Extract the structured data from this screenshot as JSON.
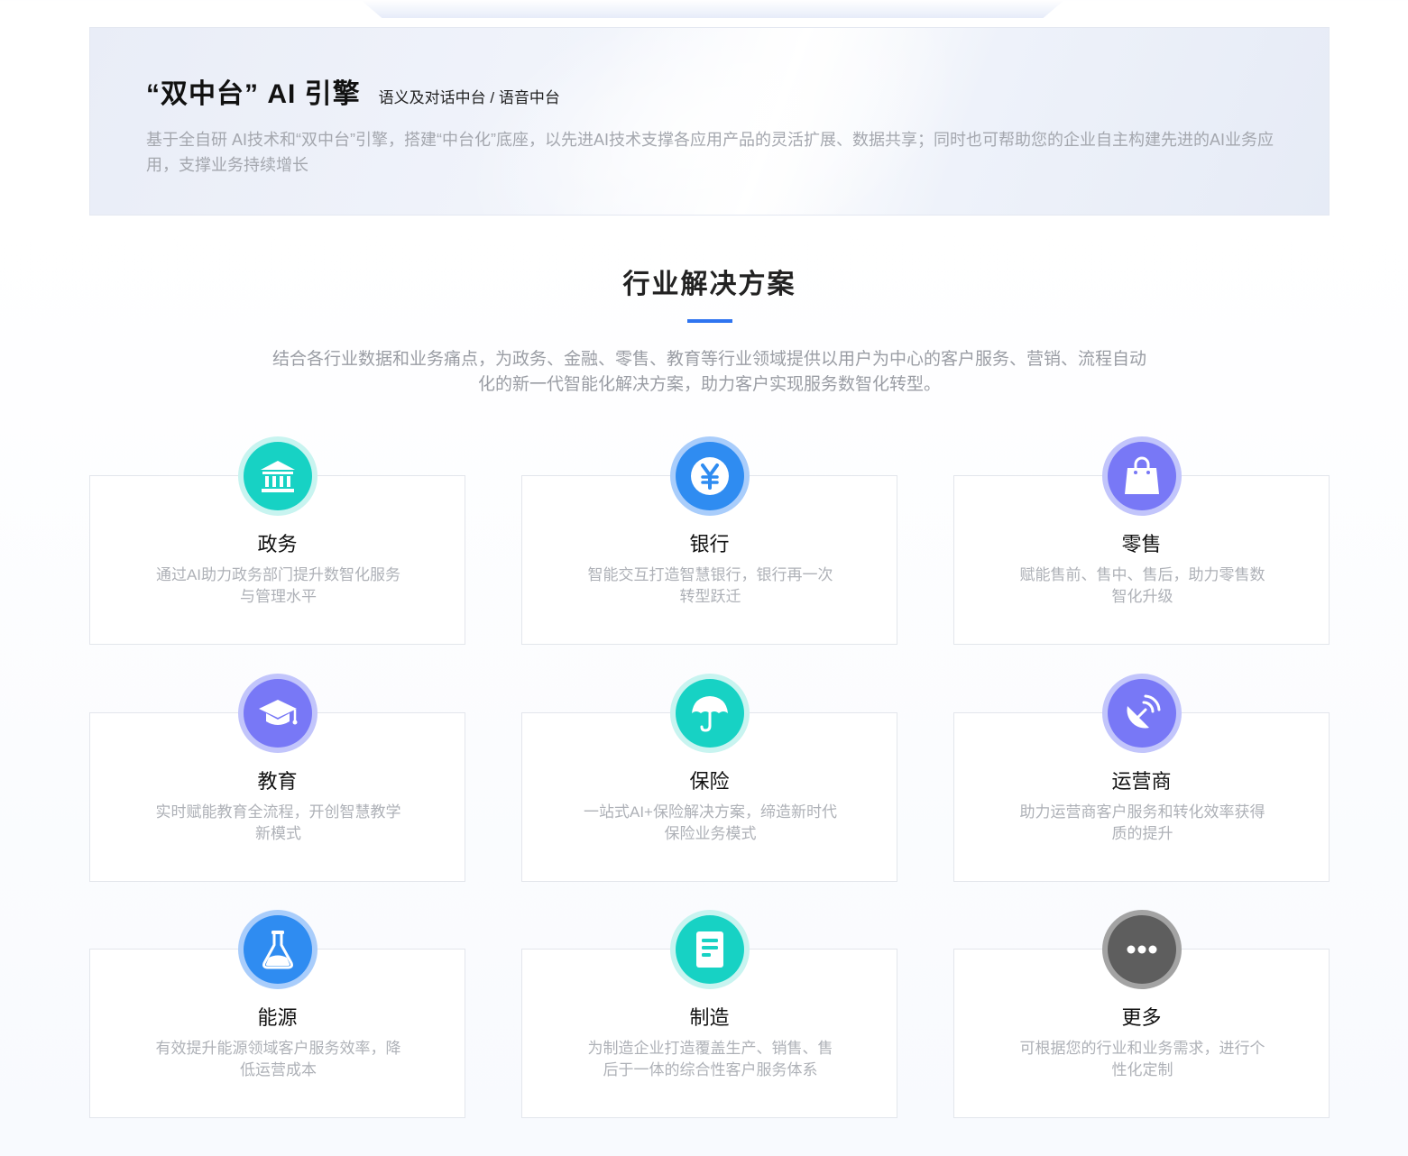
{
  "engine": {
    "title": "“双中台” AI 引擎",
    "subtitle": "语义及对话中台 / 语音中台",
    "description": "基于全自研 AI技术和“双中台”引擎，搭建“中台化”底座，以先进AI技术支撑各应用产品的灵活扩展、数据共享；同时也可帮助您的企业自主构建先进的AI业务应用，支撑业务持续增长"
  },
  "solutions": {
    "title": "行业解决方案",
    "description": "结合各行业数据和业务痛点，为政务、金融、零售、教育等行业领域提供以用户为中心的客户服务、营销、流程自动化的新一代智能化解决方案，助力客户实现服务数智化转型。",
    "items": [
      {
        "title": "政务",
        "desc": "通过AI助力政务部门提升数智化服务与管理水平",
        "icon": "government-building-icon",
        "color": "#17d2c4"
      },
      {
        "title": "银行",
        "desc": "智能交互打造智慧银行，银行再一次转型跃迁",
        "icon": "yen-coin-icon",
        "color": "#2f8cf1"
      },
      {
        "title": "零售",
        "desc": "赋能售前、售中、售后，助力零售数智化升级",
        "icon": "shopping-bag-icon",
        "color": "#7878f6"
      },
      {
        "title": "教育",
        "desc": "实时赋能教育全流程，开创智慧教学新模式",
        "icon": "graduation-cap-icon",
        "color": "#7878f6"
      },
      {
        "title": "保险",
        "desc": "一站式AI+保险解决方案，缔造新时代保险业务模式",
        "icon": "umbrella-icon",
        "color": "#17d2c4"
      },
      {
        "title": "运营商",
        "desc": "助力运营商客户服务和转化效率获得质的提升",
        "icon": "satellite-dish-icon",
        "color": "#7878f6"
      },
      {
        "title": "能源",
        "desc": "有效提升能源领域客户服务效率，降低运营成本",
        "icon": "flask-icon",
        "color": "#2f8cf1"
      },
      {
        "title": "制造",
        "desc": "为制造企业打造覆盖生产、销售、售后于一体的综合性客户服务体系",
        "icon": "document-icon",
        "color": "#17d2c4"
      },
      {
        "title": "更多",
        "desc": "可根据您的行业和业务需求，进行个性化定制",
        "icon": "more-dots-icon",
        "color": "#5e5e5e"
      }
    ]
  }
}
